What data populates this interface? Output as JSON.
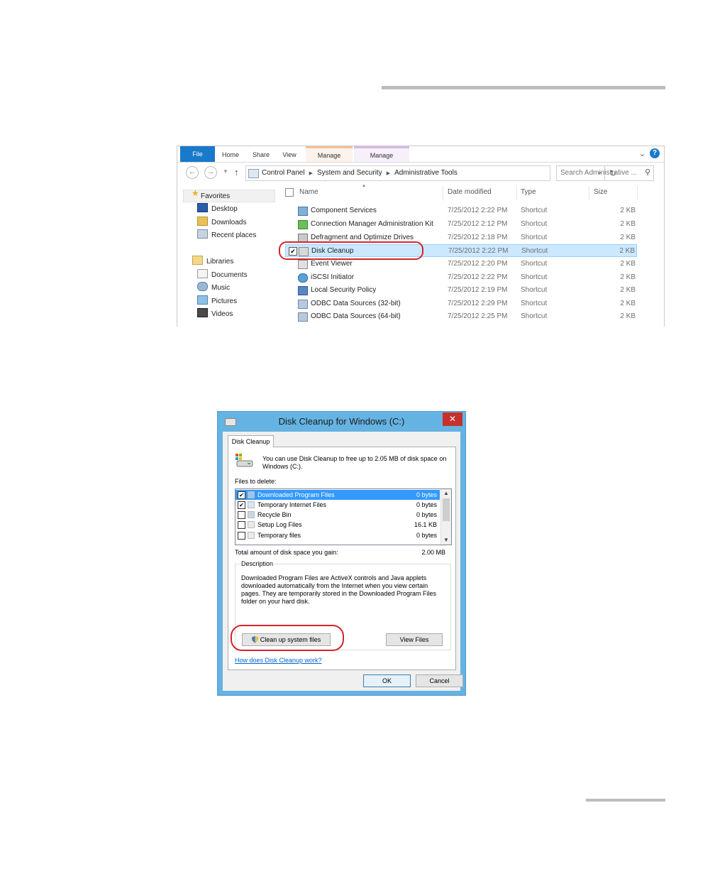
{
  "explorer": {
    "tabs": {
      "file": "File",
      "home": "Home",
      "share": "Share",
      "view": "View",
      "manage1": "Manage",
      "manage2": "Manage"
    },
    "help": "?",
    "address": [
      "Control Panel",
      "System and Security",
      "Administrative Tools"
    ],
    "search_placeholder": "Search Administrative ...",
    "nav": {
      "favorites": "Favorites",
      "desktop": "Desktop",
      "downloads": "Downloads",
      "recent": "Recent places",
      "libraries": "Libraries",
      "documents": "Documents",
      "music": "Music",
      "pictures": "Pictures",
      "videos": "Videos"
    },
    "columns": {
      "name": "Name",
      "date": "Date modified",
      "type": "Type",
      "size": "Size"
    },
    "files": [
      {
        "name": "Component Services",
        "date": "7/25/2012 2:22 PM",
        "type": "Shortcut",
        "size": "2 KB"
      },
      {
        "name": "Connection Manager Administration Kit",
        "date": "7/25/2012 2:12 PM",
        "type": "Shortcut",
        "size": "2 KB"
      },
      {
        "name": "Defragment and Optimize Drives",
        "date": "7/25/2012 2:18 PM",
        "type": "Shortcut",
        "size": "2 KB"
      },
      {
        "name": "Disk Cleanup",
        "date": "7/25/2012 2:22 PM",
        "type": "Shortcut",
        "size": "2 KB",
        "selected": true
      },
      {
        "name": "Event Viewer",
        "date": "7/25/2012 2:20 PM",
        "type": "Shortcut",
        "size": "2 KB"
      },
      {
        "name": "iSCSI Initiator",
        "date": "7/25/2012 2:22 PM",
        "type": "Shortcut",
        "size": "2 KB"
      },
      {
        "name": "Local Security Policy",
        "date": "7/25/2012 2:19 PM",
        "type": "Shortcut",
        "size": "2 KB"
      },
      {
        "name": "ODBC Data Sources (32-bit)",
        "date": "7/25/2012 2:29 PM",
        "type": "Shortcut",
        "size": "2 KB"
      },
      {
        "name": "ODBC Data Sources (64-bit)",
        "date": "7/25/2012 2:25 PM",
        "type": "Shortcut",
        "size": "2 KB"
      }
    ]
  },
  "dialog": {
    "title": "Disk Cleanup for Windows (C:)",
    "close": "✕",
    "tab": "Disk Cleanup",
    "intro": "You can use Disk Cleanup to free up to 2.05 MB of disk space on Windows (C:).",
    "files_label": "Files to delete:",
    "items": [
      {
        "name": "Downloaded Program Files",
        "size": "0 bytes",
        "checked": true,
        "selected": true
      },
      {
        "name": "Temporary Internet Files",
        "size": "0 bytes",
        "checked": true
      },
      {
        "name": "Recycle Bin",
        "size": "0 bytes",
        "checked": false
      },
      {
        "name": "Setup Log Files",
        "size": "16.1 KB",
        "checked": false
      },
      {
        "name": "Temporary files",
        "size": "0 bytes",
        "checked": false
      }
    ],
    "total_label": "Total amount of disk space you gain:",
    "total_value": "2.00 MB",
    "description_title": "Description",
    "description": "Downloaded Program Files are ActiveX controls and Java applets downloaded automatically from the Internet when you view certain pages. They are temporarily stored in the Downloaded Program Files folder on your hard disk.",
    "cleanup_button": "Clean up system files",
    "view_files_button": "View Files",
    "help_link": "How does Disk Cleanup work?",
    "ok": "OK",
    "cancel": "Cancel"
  },
  "colors": {
    "accent": "#1979ca",
    "titlebar": "#65b3e2",
    "close": "#c7312b",
    "callout": "#d7242b",
    "selection": "#cce8ff"
  }
}
